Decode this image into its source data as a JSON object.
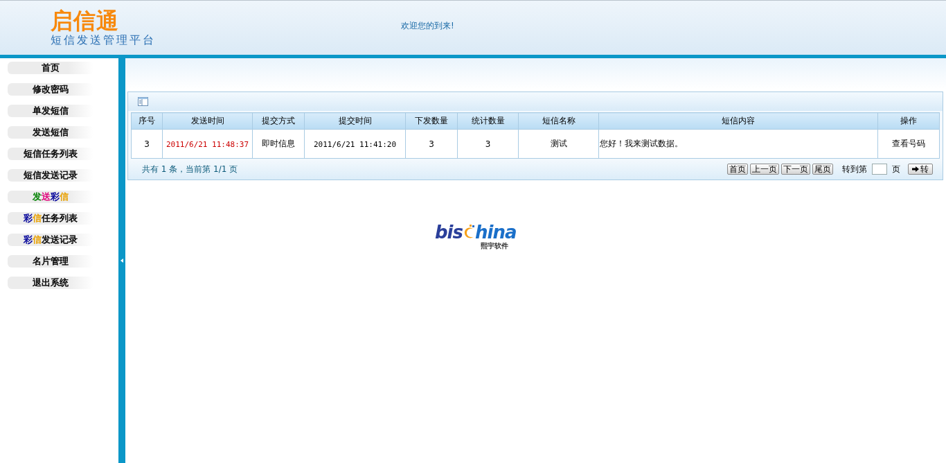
{
  "header": {
    "logo_title": "启信通",
    "logo_subtitle": "短信发送管理平台",
    "welcome": "欢迎您的到来!"
  },
  "sidebar": {
    "items": [
      {
        "segments": [
          {
            "text": "首页",
            "color": "#000000"
          }
        ]
      },
      {
        "segments": [
          {
            "text": "修改密码",
            "color": "#000000"
          }
        ]
      },
      {
        "segments": [
          {
            "text": "单发短信",
            "color": "#000000"
          }
        ]
      },
      {
        "segments": [
          {
            "text": "发送短信",
            "color": "#000000"
          }
        ]
      },
      {
        "segments": [
          {
            "text": "短信任务列表",
            "color": "#000000"
          }
        ]
      },
      {
        "segments": [
          {
            "text": "短信发送记录",
            "color": "#000000"
          }
        ]
      },
      {
        "segments": [
          {
            "text": "发",
            "color": "#008000"
          },
          {
            "text": "送",
            "color": "#e0007a"
          },
          {
            "text": "彩",
            "color": "#000099"
          },
          {
            "text": "信",
            "color": "#e8a000"
          }
        ]
      },
      {
        "segments": [
          {
            "text": "彩",
            "color": "#000099"
          },
          {
            "text": "信",
            "color": "#e8a000"
          },
          {
            "text": "任务列表",
            "color": "#000000"
          }
        ]
      },
      {
        "segments": [
          {
            "text": "彩",
            "color": "#000099"
          },
          {
            "text": "信",
            "color": "#e8a000"
          },
          {
            "text": "发送记录",
            "color": "#000000"
          }
        ]
      },
      {
        "segments": [
          {
            "text": "名片管理",
            "color": "#000000"
          }
        ]
      },
      {
        "segments": [
          {
            "text": "退出系统",
            "color": "#000000"
          }
        ]
      }
    ]
  },
  "table": {
    "columns": [
      "序号",
      "发送时间",
      "提交方式",
      "提交时间",
      "下发数量",
      "统计数量",
      "短信名称",
      "短信内容",
      "操作"
    ],
    "rows": [
      [
        "3",
        "2011/6/21 11:48:37",
        "即时信息",
        "2011/6/21 11:41:20",
        "3",
        "3",
        "测试",
        "您好！我来测试数据。",
        "查看号码"
      ]
    ]
  },
  "pager": {
    "summary": "共有 1 条，当前第 1/1 页",
    "buttons": [
      "首页",
      "上一页",
      "下一页",
      "尾页"
    ],
    "goto_label": "转到第",
    "page_label": "页",
    "go_button": "转"
  },
  "logo": {
    "part1": "bis",
    "part2": "hina",
    "caption": "熙宇软件"
  }
}
